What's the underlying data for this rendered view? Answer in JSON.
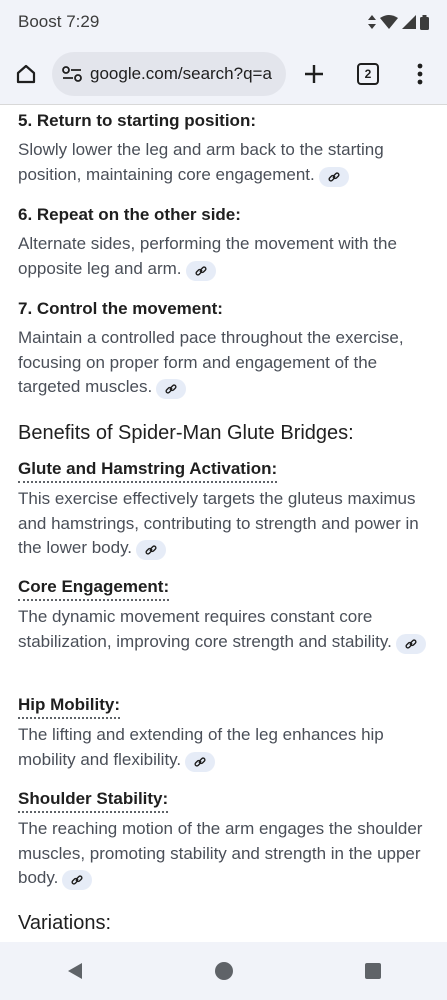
{
  "status_bar": {
    "carrier_time": "Boost 7:29"
  },
  "toolbar": {
    "url": "google.com/search?q=a",
    "tab_count": "2"
  },
  "steps": [
    {
      "title": "5. Return to starting position:",
      "text": "Slowly lower the leg and arm back to the starting position, maintaining core engagement."
    },
    {
      "title": "6. Repeat on the other side:",
      "text": "Alternate sides, performing the movement with the opposite leg and arm."
    },
    {
      "title": "7. Control the movement:",
      "text": "Maintain a controlled pace throughout the exercise, focusing on proper form and engagement of the targeted muscles."
    }
  ],
  "benefits_heading": "Benefits of Spider-Man Glute Bridges:",
  "benefits": [
    {
      "title": "Glute and Hamstring Activation:",
      "text": "This exercise effectively targets the gluteus maximus and hamstrings, contributing to strength and power in the lower body."
    },
    {
      "title": "Core Engagement:",
      "text": "The dynamic movement requires constant core stabilization, improving core strength and stability."
    },
    {
      "title": "Hip Mobility:",
      "text": "The lifting and extending of the leg enhances hip mobility and flexibility."
    },
    {
      "title": "Shoulder Stability:",
      "text": "The reaching motion of the arm engages the shoulder muscles, promoting stability and strength in the upper body."
    }
  ],
  "variations_heading": "Variations:",
  "icons": {
    "home": "home-icon",
    "site_info": "site-info-icon",
    "new_tab": "plus-icon",
    "menu": "more-vert-icon",
    "link": "link-icon",
    "back": "back-icon",
    "nav_home": "circle-home-icon",
    "recents": "recents-icon"
  }
}
